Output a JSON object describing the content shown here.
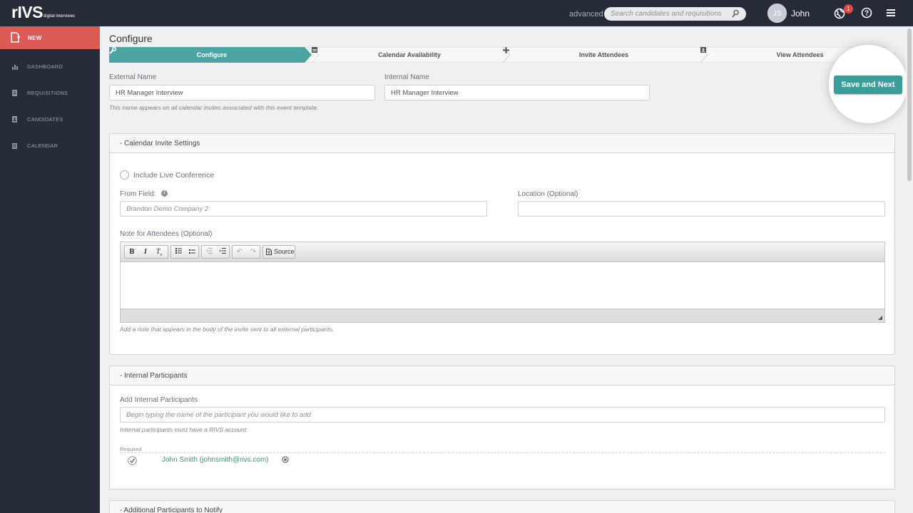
{
  "app": {
    "logo": "rIVS",
    "logo_tagline": "digital interviews"
  },
  "header": {
    "mode_label": "advanced",
    "search_placeholder": "Search candidates and requisitions",
    "avatar_initials": "JS",
    "user_name": "John",
    "notification_count": "1"
  },
  "sidebar": {
    "new_label": "NEW",
    "items": [
      {
        "label": "DASHBOARD",
        "icon": "bar-chart-icon"
      },
      {
        "label": "REQUISITIONS",
        "icon": "document-icon"
      },
      {
        "label": "CANDIDATES",
        "icon": "id-card-icon"
      },
      {
        "label": "CALENDAR",
        "icon": "calendar-icon"
      }
    ]
  },
  "page": {
    "title": "Configure",
    "steps": [
      {
        "label": "Configure",
        "icon": "wrench-icon",
        "active": true
      },
      {
        "label": "Calendar Availability",
        "icon": "calendar-icon",
        "active": false
      },
      {
        "label": "Invite Attendees",
        "icon": "plus-icon",
        "active": false
      },
      {
        "label": "View Attendees",
        "icon": "person-icon",
        "active": false
      }
    ],
    "save_label": "Save and Next"
  },
  "names": {
    "external_label": "External Name",
    "external_value": "HR Manager Interview",
    "internal_label": "Internal Name",
    "internal_value": "HR Manager Interview",
    "hint": "This name appears on all calendar invites associated with this event template."
  },
  "calendar_settings": {
    "title": "- Calendar Invite Settings",
    "live_conference_label": "Include Live Conference",
    "from_label": "From Field:",
    "from_placeholder": "Brandon Demo Company 2",
    "location_label": "Location (Optional)",
    "location_value": "",
    "note_label": "Note for Attendees (Optional)",
    "editor_source_label": "Source",
    "note_hint": "Add a note that appears in the body of the invite sent to all external participants."
  },
  "internal_participants": {
    "title": "- Internal Participants",
    "add_label": "Add Internal Participants",
    "add_placeholder": "Begin typing the name of the participant you would like to add",
    "hint": "Internal participants must have a RIVS account.",
    "required_label": "Required",
    "participants": [
      {
        "name": "John Smith (johnsmith@rivs.com)"
      }
    ]
  },
  "additional": {
    "title": "- Additional Participants to Notify"
  },
  "colors": {
    "topbar": "#252c37",
    "accent_teal": "#3b9d9a",
    "new_red": "#dc5a55",
    "participant_green": "#3e9a72"
  }
}
